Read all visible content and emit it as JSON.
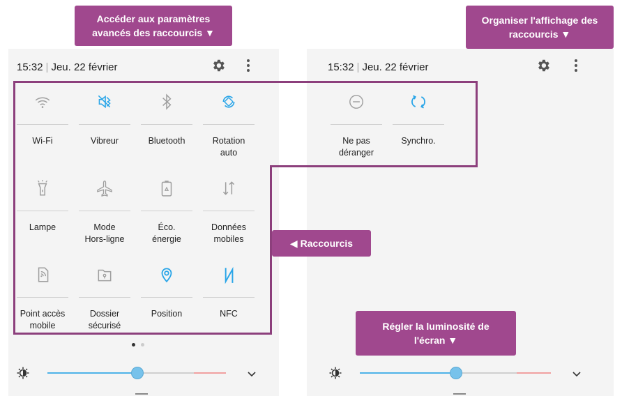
{
  "callouts": {
    "advanced": "Accéder aux paramètres\navancés des raccourcis ▼",
    "organize": "Organiser l'affichage des\nraccourcis ▼",
    "shortcuts": "◀ Raccourcis",
    "brightness": "Régler la luminosité de\nl'écran ▼"
  },
  "status_bar": {
    "time": "15:32",
    "separator": "|",
    "date": "Jeu. 22 février"
  },
  "left_tiles": [
    {
      "label": "Wi-Fi",
      "icon": "wifi-icon",
      "active": false
    },
    {
      "label": "Vibreur",
      "icon": "vibrate-icon",
      "active": true
    },
    {
      "label": "Bluetooth",
      "icon": "bluetooth-icon",
      "active": false
    },
    {
      "label": "Rotation\nauto",
      "icon": "rotation-icon",
      "active": true
    },
    {
      "label": "Lampe",
      "icon": "flashlight-icon",
      "active": false
    },
    {
      "label": "Mode\nHors-ligne",
      "icon": "airplane-icon",
      "active": false
    },
    {
      "label": "Éco.\nénergie",
      "icon": "battery-eco-icon",
      "active": false
    },
    {
      "label": "Données\nmobiles",
      "icon": "mobile-data-icon",
      "active": false
    },
    {
      "label": "Point accès\nmobile",
      "icon": "hotspot-icon",
      "active": false
    },
    {
      "label": "Dossier\nsécurisé",
      "icon": "secure-folder-icon",
      "active": false
    },
    {
      "label": "Position",
      "icon": "location-icon",
      "active": true
    },
    {
      "label": "NFC",
      "icon": "nfc-icon",
      "active": true
    }
  ],
  "right_tiles": [
    {
      "label": "Ne pas\ndéranger",
      "icon": "do-not-disturb-icon",
      "active": false
    },
    {
      "label": "Synchro.",
      "icon": "sync-icon",
      "active": true
    }
  ],
  "brightness": {
    "left_level": 0.5,
    "right_level": 0.5
  },
  "page_indicator": {
    "count": 2,
    "current": 1
  },
  "colors": {
    "callout": "#a0488e",
    "frame": "#8c3f7c",
    "active_icon": "#29a5e8",
    "inactive_icon": "#9e9e9e",
    "slider_fill": "#4db2e8",
    "slider_rest": "#cfcfcf",
    "slider_end": "#f0a0a0"
  }
}
